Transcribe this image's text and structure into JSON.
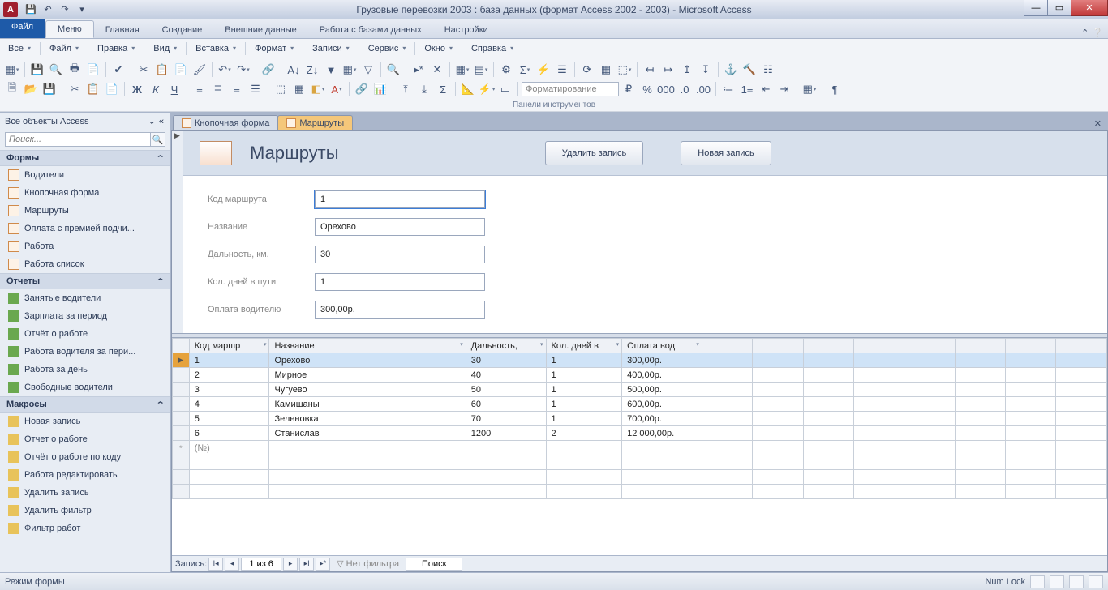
{
  "title": "Грузовые перевозки 2003 : база данных (формат Access 2002 - 2003)  -  Microsoft Access",
  "app_letter": "A",
  "ribbon": {
    "file": "Файл",
    "tabs": [
      "Меню",
      "Главная",
      "Создание",
      "Внешние данные",
      "Работа с базами данных",
      "Настройки"
    ],
    "active": 0
  },
  "menubar": [
    "Все",
    "Файл",
    "Правка",
    "Вид",
    "Вставка",
    "Формат",
    "Записи",
    "Сервис",
    "Окно",
    "Справка"
  ],
  "formatting_placeholder": "Форматирование",
  "panel_label": "Панели инструментов",
  "nav": {
    "header": "Все объекты Access",
    "search_placeholder": "Поиск...",
    "sections": [
      {
        "title": "Формы",
        "icon": "form",
        "items": [
          "Водители",
          "Кнопочная форма",
          "Маршруты",
          "Оплата с премией подчи...",
          "Работа",
          "Работа список"
        ]
      },
      {
        "title": "Отчеты",
        "icon": "report",
        "items": [
          "Занятые водители",
          "Зарплата за период",
          "Отчёт о работе",
          "Работа водителя за пери...",
          "Работа за день",
          "Свободные водители"
        ]
      },
      {
        "title": "Макросы",
        "icon": "macro",
        "items": [
          "Новая запись",
          "Отчет о работе",
          "Отчёт о работе по коду",
          "Работа редактировать",
          "Удалить запись",
          "Удалить фильтр",
          "Фильтр работ"
        ]
      }
    ]
  },
  "doc_tabs": [
    {
      "label": "Кнопочная форма",
      "active": false
    },
    {
      "label": "Маршруты",
      "active": true
    }
  ],
  "form": {
    "title": "Маршруты",
    "buttons": {
      "delete": "Удалить запись",
      "new": "Новая запись"
    },
    "fields": [
      {
        "label": "Код маршрута",
        "value": "1"
      },
      {
        "label": "Название",
        "value": "Орехово"
      },
      {
        "label": "Дальность, км.",
        "value": "30"
      },
      {
        "label": "Кол. дней в пути",
        "value": "1"
      },
      {
        "label": "Оплата водителю",
        "value": "300,00р."
      }
    ]
  },
  "grid": {
    "columns": [
      "Код маршр",
      "Название",
      "Дальность,",
      "Кол. дней в",
      "Оплата вод"
    ],
    "rows": [
      [
        "1",
        "Орехово",
        "30",
        "1",
        "300,00р."
      ],
      [
        "2",
        "Мирное",
        "40",
        "1",
        "400,00р."
      ],
      [
        "3",
        "Чугуево",
        "50",
        "1",
        "500,00р."
      ],
      [
        "4",
        "Камишаны",
        "60",
        "1",
        "600,00р."
      ],
      [
        "5",
        "Зеленовка",
        "70",
        "1",
        "700,00р."
      ],
      [
        "6",
        "Станислав",
        "1200",
        "2",
        "12 000,00р."
      ]
    ],
    "new_placeholder": "(№)"
  },
  "recnav": {
    "label": "Запись:",
    "pos": "1 из 6",
    "nofilter": "Нет фильтра",
    "search": "Поиск"
  },
  "status": {
    "mode": "Режим формы",
    "numlock": "Num Lock"
  }
}
